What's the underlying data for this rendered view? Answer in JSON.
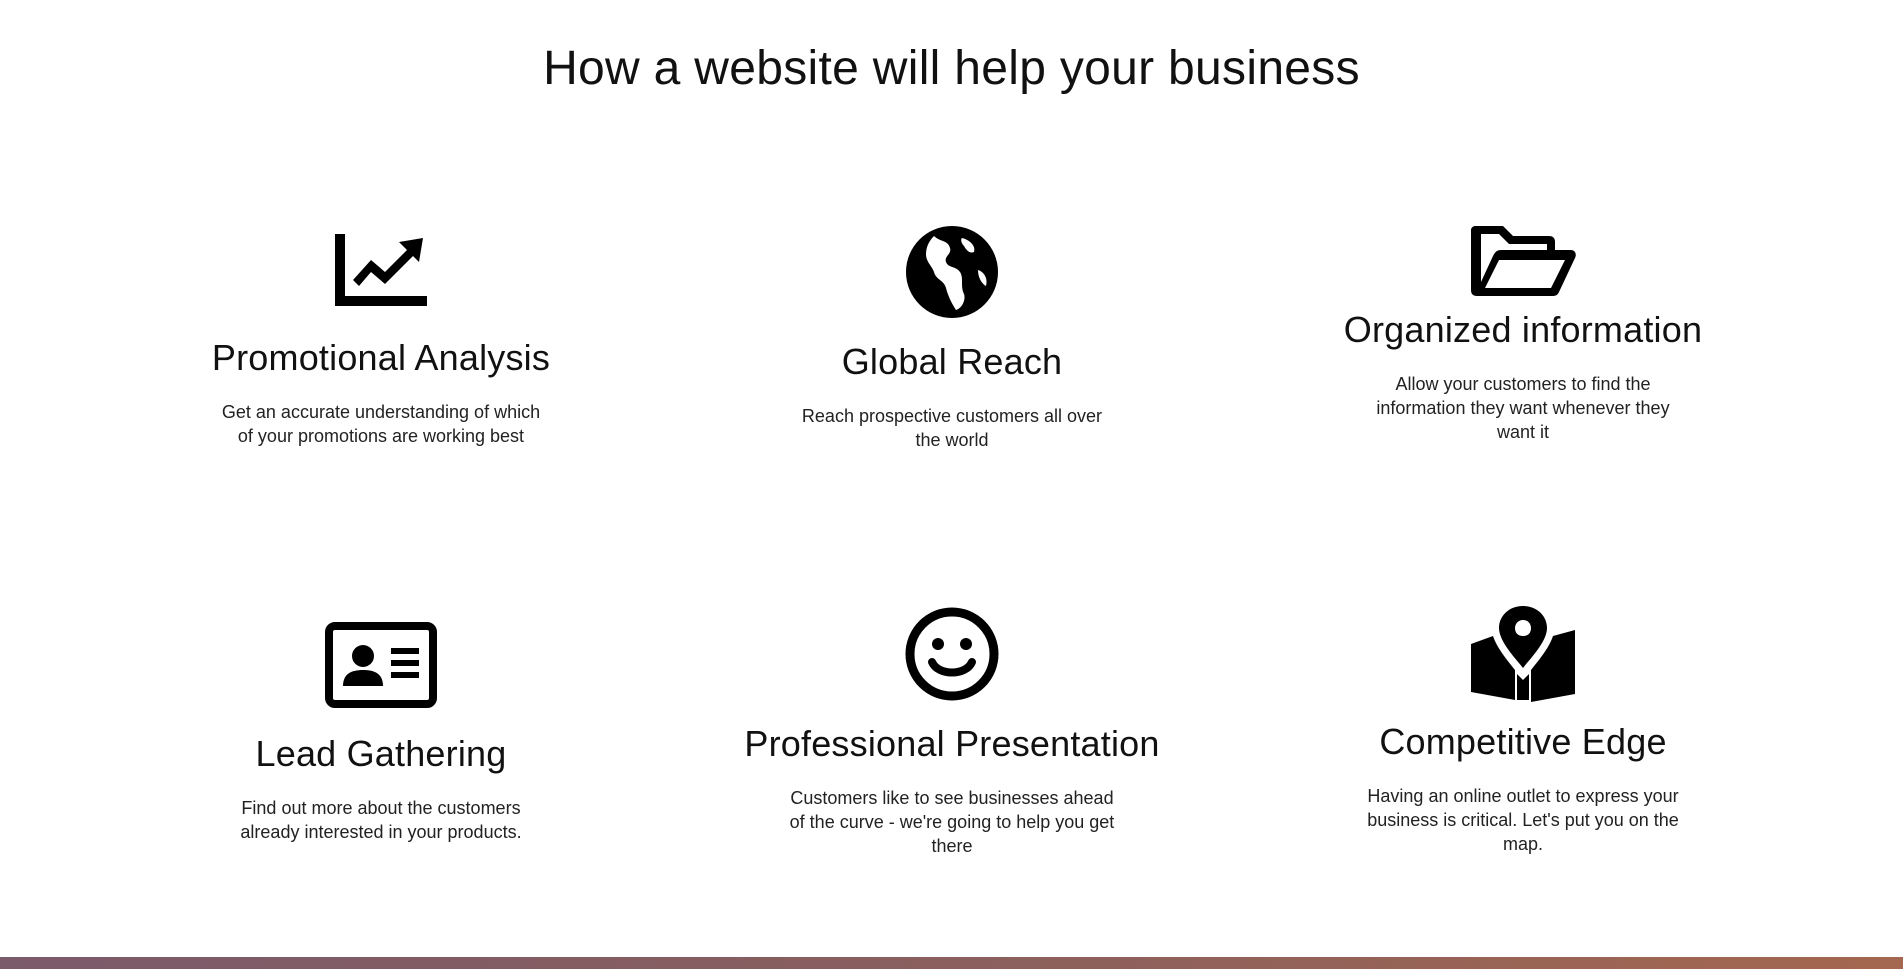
{
  "title": "How a website will help your business",
  "features": [
    {
      "icon": "chart-line-icon",
      "title": "Promotional Analysis",
      "description": "Get an accurate understanding of which of your promotions are working best"
    },
    {
      "icon": "globe-icon",
      "title": "Global Reach",
      "description": "Reach prospective customers all over the world"
    },
    {
      "icon": "folder-open-icon",
      "title": "Organized information",
      "description": "Allow your customers to find the information they want whenever they want it"
    },
    {
      "icon": "id-card-icon",
      "title": "Lead Gathering",
      "description": "Find out more about the customers already interested in your products."
    },
    {
      "icon": "smile-icon",
      "title": "Professional Presentation",
      "description": "Customers like to see businesses ahead of the curve - we're going to help you get there"
    },
    {
      "icon": "map-marked-icon",
      "title": "Competitive Edge",
      "description": "Having an online outlet to express your business is critical. Let's put you on the map."
    }
  ],
  "colors": {
    "text": "#111111",
    "band_start": "#7b5a6a",
    "band_end": "#a4674f"
  }
}
